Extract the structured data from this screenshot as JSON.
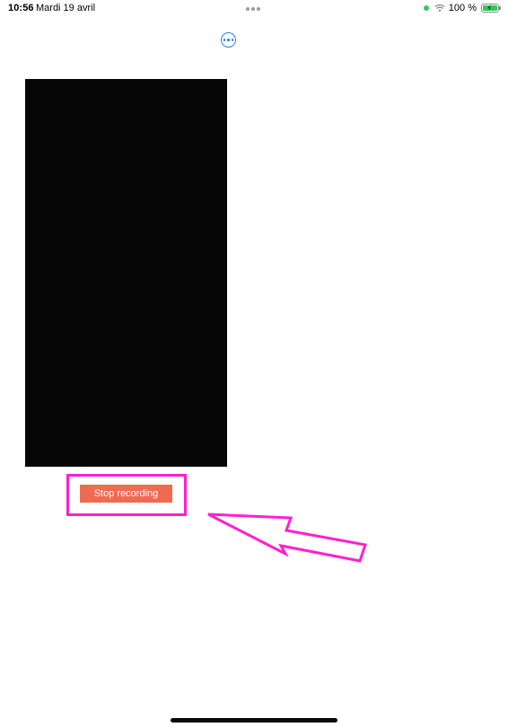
{
  "status_bar": {
    "time": "10:56",
    "date": "Mardi 19 avril",
    "battery": "100 %",
    "battery_level": 1.0,
    "icons": [
      "green-dot-indicator",
      "wifi-icon",
      "battery-charging-icon"
    ]
  },
  "toolbar": {
    "more_icon": "ellipsis-circle-icon"
  },
  "main": {
    "stop_recording_label": "Stop recording"
  },
  "annotation": {
    "highlight_color": "#ff1fd1"
  },
  "colors": {
    "accent": "#2f7cf6",
    "stop_button": "#ee6b52",
    "preview_bg": "#060606"
  }
}
